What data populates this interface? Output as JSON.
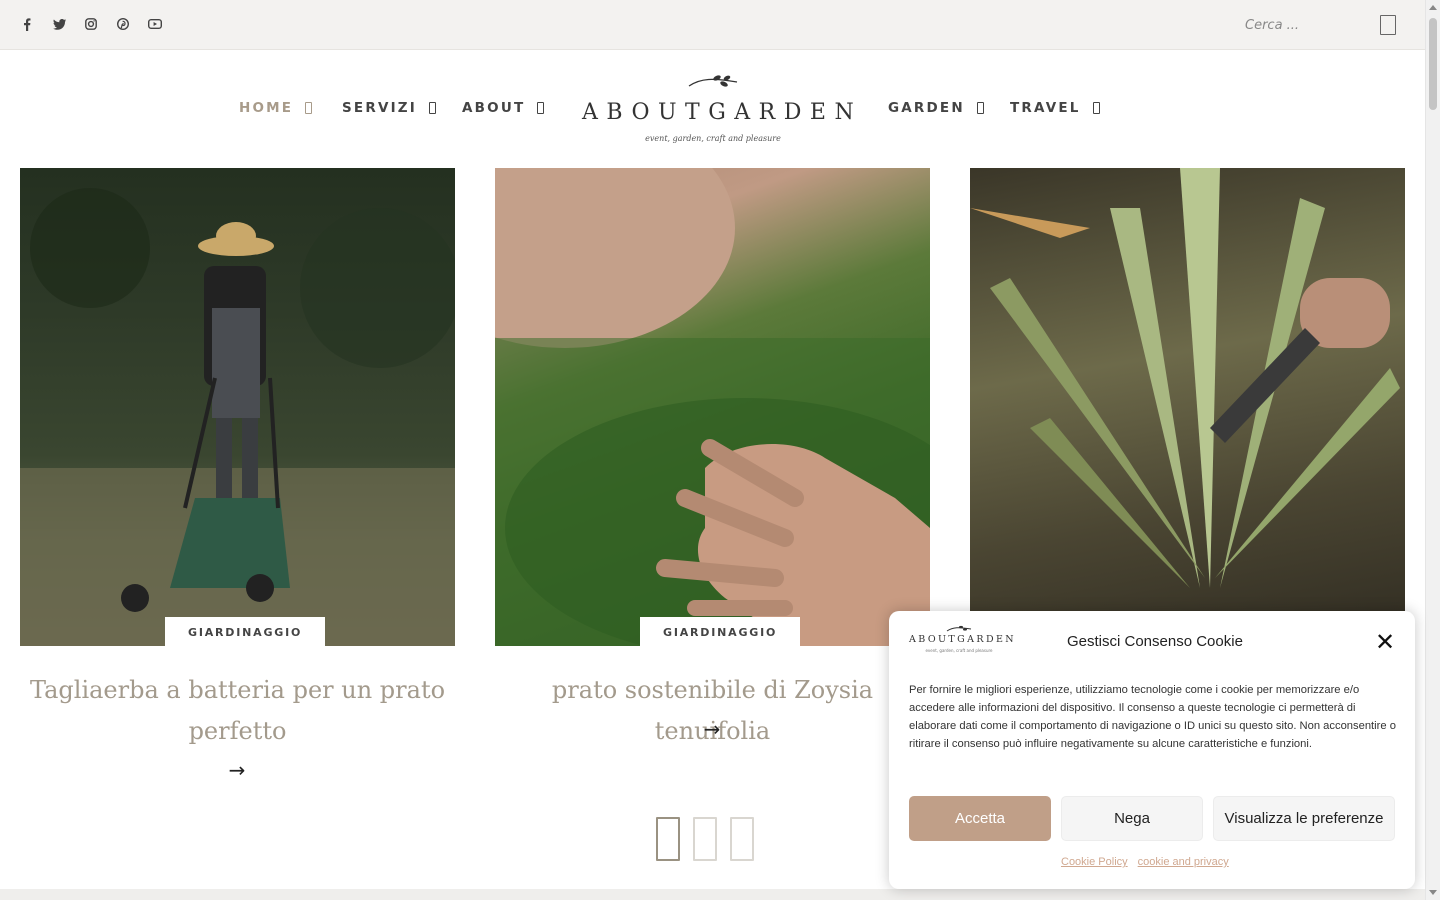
{
  "topbar": {
    "social_icons": [
      "facebook-icon",
      "twitter-icon",
      "instagram-icon",
      "pinterest-icon",
      "youtube-icon"
    ],
    "search": {
      "placeholder": "Cerca ..."
    }
  },
  "nav": {
    "items": [
      {
        "label": "HOME",
        "active": true
      },
      {
        "label": "SERVIZI",
        "active": false
      },
      {
        "label": "ABOUT",
        "active": false
      },
      {
        "label": "GARDEN",
        "active": false
      },
      {
        "label": "TRAVEL",
        "active": false
      }
    ]
  },
  "logo": {
    "wordmark": "ABOUTGARDEN",
    "tagline": "event, garden, craft and pleasure"
  },
  "cards": [
    {
      "category": "GIARDINAGGIO",
      "title": "Tagliaerba a batteria per un prato perfetto",
      "more": "→"
    },
    {
      "category": "GIARDINAGGIO",
      "title": "prato sostenibile di Zoysia tenuifolia",
      "more": "→"
    },
    {
      "category": "",
      "title": "",
      "more": ""
    }
  ],
  "pager": {
    "count": 3,
    "active_index": 0
  },
  "cookie": {
    "logo_wordmark": "ABOUTGARDEN",
    "logo_tagline": "event, garden, craft and pleasure",
    "title": "Gestisci Consenso Cookie",
    "close": "✕",
    "body": "Per fornire le migliori esperienze, utilizziamo tecnologie come i cookie per memorizzare e/o accedere alle informazioni del dispositivo. Il consenso a queste tecnologie ci permetterà di elaborare dati come il comportamento di navigazione o ID unici su questo sito. Non acconsentire o ritirare il consenso può influire negativamente su alcune caratteristiche e funzioni.",
    "accept_label": "Accetta",
    "deny_label": "Nega",
    "prefs_label": "Visualizza le preferenze",
    "link_policy": "Cookie Policy",
    "link_privacy": "cookie and privacy"
  },
  "colors": {
    "accent": "#c09f88",
    "nav_active": "#a89b8a",
    "title_text": "#a39a8c"
  }
}
